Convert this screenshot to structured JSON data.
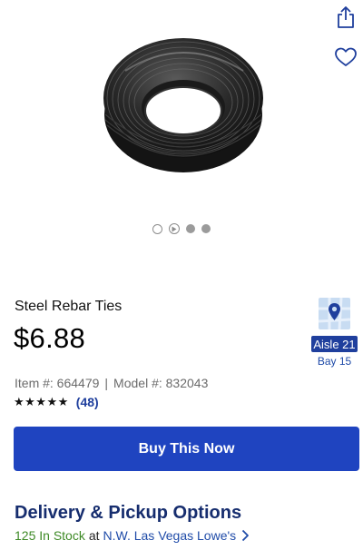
{
  "header": {
    "share_icon": "share-icon",
    "favorite_icon": "heart-icon"
  },
  "product": {
    "image_alt": "coil-of-black-steel-wire",
    "title": "Steel Rebar Ties",
    "price": "$6.88"
  },
  "location": {
    "aisle": "Aisle 21",
    "bay": "Bay 15",
    "icon": "store-map-icon"
  },
  "meta": {
    "item_label": "Item #: 664479",
    "separator": "|",
    "model_label": "Model #: 832043"
  },
  "rating": {
    "stars": "★★★★★",
    "value": 5,
    "count": "(48)"
  },
  "actions": {
    "buy_label": "Buy This Now"
  },
  "delivery": {
    "title": "Delivery & Pickup Options",
    "stock": "125 In Stock",
    "at": "at",
    "store": "N.W. Las Vegas Lowe's"
  },
  "colors": {
    "primary_button": "#1f44c0",
    "heading_navy": "#162d6e",
    "link_blue": "#1f4ba8",
    "stock_green": "#3e8a26",
    "badge_blue": "#1f3f9d"
  }
}
